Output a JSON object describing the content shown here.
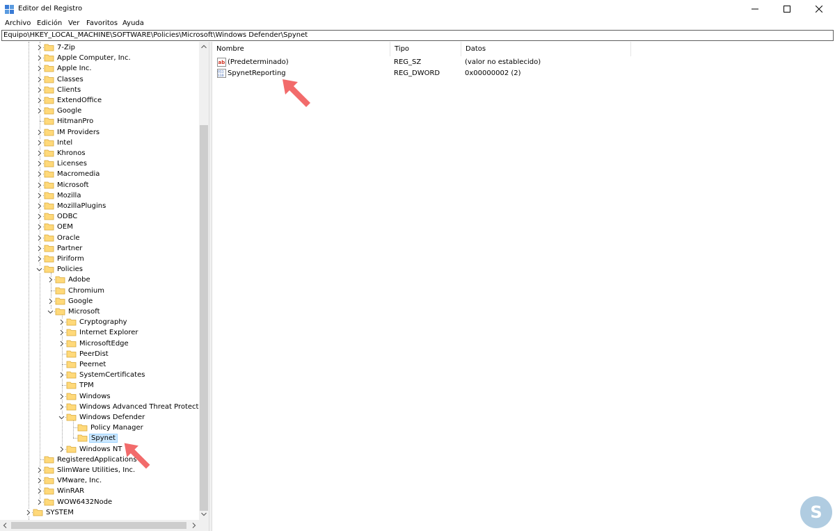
{
  "window": {
    "title": "Editor del Registro",
    "buttons": [
      "minimize",
      "maximize",
      "close"
    ]
  },
  "menu": [
    "Archivo",
    "Edición",
    "Ver",
    "Favoritos",
    "Ayuda"
  ],
  "address": "Equipo\\HKEY_LOCAL_MACHINE\\SOFTWARE\\Policies\\Microsoft\\Windows Defender\\Spynet",
  "tree": [
    {
      "label": "7-Zip",
      "level": 0,
      "expander": "collapsed"
    },
    {
      "label": "Apple Computer, Inc.",
      "level": 0,
      "expander": "collapsed"
    },
    {
      "label": "Apple Inc.",
      "level": 0,
      "expander": "collapsed"
    },
    {
      "label": "Classes",
      "level": 0,
      "expander": "collapsed"
    },
    {
      "label": "Clients",
      "level": 0,
      "expander": "collapsed"
    },
    {
      "label": "ExtendOffice",
      "level": 0,
      "expander": "collapsed"
    },
    {
      "label": "Google",
      "level": 0,
      "expander": "collapsed"
    },
    {
      "label": "HitmanPro",
      "level": 0,
      "expander": "none"
    },
    {
      "label": "IM Providers",
      "level": 0,
      "expander": "collapsed"
    },
    {
      "label": "Intel",
      "level": 0,
      "expander": "collapsed"
    },
    {
      "label": "Khronos",
      "level": 0,
      "expander": "collapsed"
    },
    {
      "label": "Licenses",
      "level": 0,
      "expander": "collapsed"
    },
    {
      "label": "Macromedia",
      "level": 0,
      "expander": "collapsed"
    },
    {
      "label": "Microsoft",
      "level": 0,
      "expander": "collapsed"
    },
    {
      "label": "Mozilla",
      "level": 0,
      "expander": "collapsed"
    },
    {
      "label": "MozillaPlugins",
      "level": 0,
      "expander": "collapsed"
    },
    {
      "label": "ODBC",
      "level": 0,
      "expander": "collapsed"
    },
    {
      "label": "OEM",
      "level": 0,
      "expander": "collapsed"
    },
    {
      "label": "Oracle",
      "level": 0,
      "expander": "collapsed"
    },
    {
      "label": "Partner",
      "level": 0,
      "expander": "collapsed"
    },
    {
      "label": "Piriform",
      "level": 0,
      "expander": "collapsed"
    },
    {
      "label": "Policies",
      "level": 0,
      "expander": "expanded"
    },
    {
      "label": "Adobe",
      "level": 1,
      "expander": "collapsed"
    },
    {
      "label": "Chromium",
      "level": 1,
      "expander": "none"
    },
    {
      "label": "Google",
      "level": 1,
      "expander": "collapsed"
    },
    {
      "label": "Microsoft",
      "level": 1,
      "expander": "expanded"
    },
    {
      "label": "Cryptography",
      "level": 2,
      "expander": "collapsed"
    },
    {
      "label": "Internet Explorer",
      "level": 2,
      "expander": "collapsed"
    },
    {
      "label": "MicrosoftEdge",
      "level": 2,
      "expander": "collapsed"
    },
    {
      "label": "PeerDist",
      "level": 2,
      "expander": "none"
    },
    {
      "label": "Peernet",
      "level": 2,
      "expander": "none"
    },
    {
      "label": "SystemCertificates",
      "level": 2,
      "expander": "collapsed"
    },
    {
      "label": "TPM",
      "level": 2,
      "expander": "none"
    },
    {
      "label": "Windows",
      "level": 2,
      "expander": "collapsed"
    },
    {
      "label": "Windows Advanced Threat Protection",
      "level": 2,
      "expander": "collapsed"
    },
    {
      "label": "Windows Defender",
      "level": 2,
      "expander": "expanded"
    },
    {
      "label": "Policy Manager",
      "level": 3,
      "expander": "none"
    },
    {
      "label": "Spynet",
      "level": 3,
      "expander": "none",
      "selected": true
    },
    {
      "label": "Windows NT",
      "level": 2,
      "expander": "collapsed"
    },
    {
      "label": "RegisteredApplications",
      "level": 0,
      "expander": "none"
    },
    {
      "label": "SlimWare Utilities, Inc.",
      "level": 0,
      "expander": "collapsed"
    },
    {
      "label": "VMware, Inc.",
      "level": 0,
      "expander": "collapsed"
    },
    {
      "label": "WinRAR",
      "level": 0,
      "expander": "collapsed"
    },
    {
      "label": "WOW6432Node",
      "level": 0,
      "expander": "collapsed"
    },
    {
      "label": "SYSTEM",
      "level": -1,
      "expander": "collapsed"
    }
  ],
  "list": {
    "columns": [
      "Nombre",
      "Tipo",
      "Datos"
    ],
    "rows": [
      {
        "icon": "string-value-icon",
        "name": "(Predeterminado)",
        "type": "REG_SZ",
        "data": "(valor no establecido)"
      },
      {
        "icon": "dword-value-icon",
        "name": "SpynetReporting",
        "type": "REG_DWORD",
        "data": "0x00000002 (2)"
      }
    ]
  },
  "colors": {
    "selection": "#cce8ff",
    "arrow": "#f26b6b",
    "folder": "#ffd97a",
    "logo": "#6fa3c8"
  }
}
